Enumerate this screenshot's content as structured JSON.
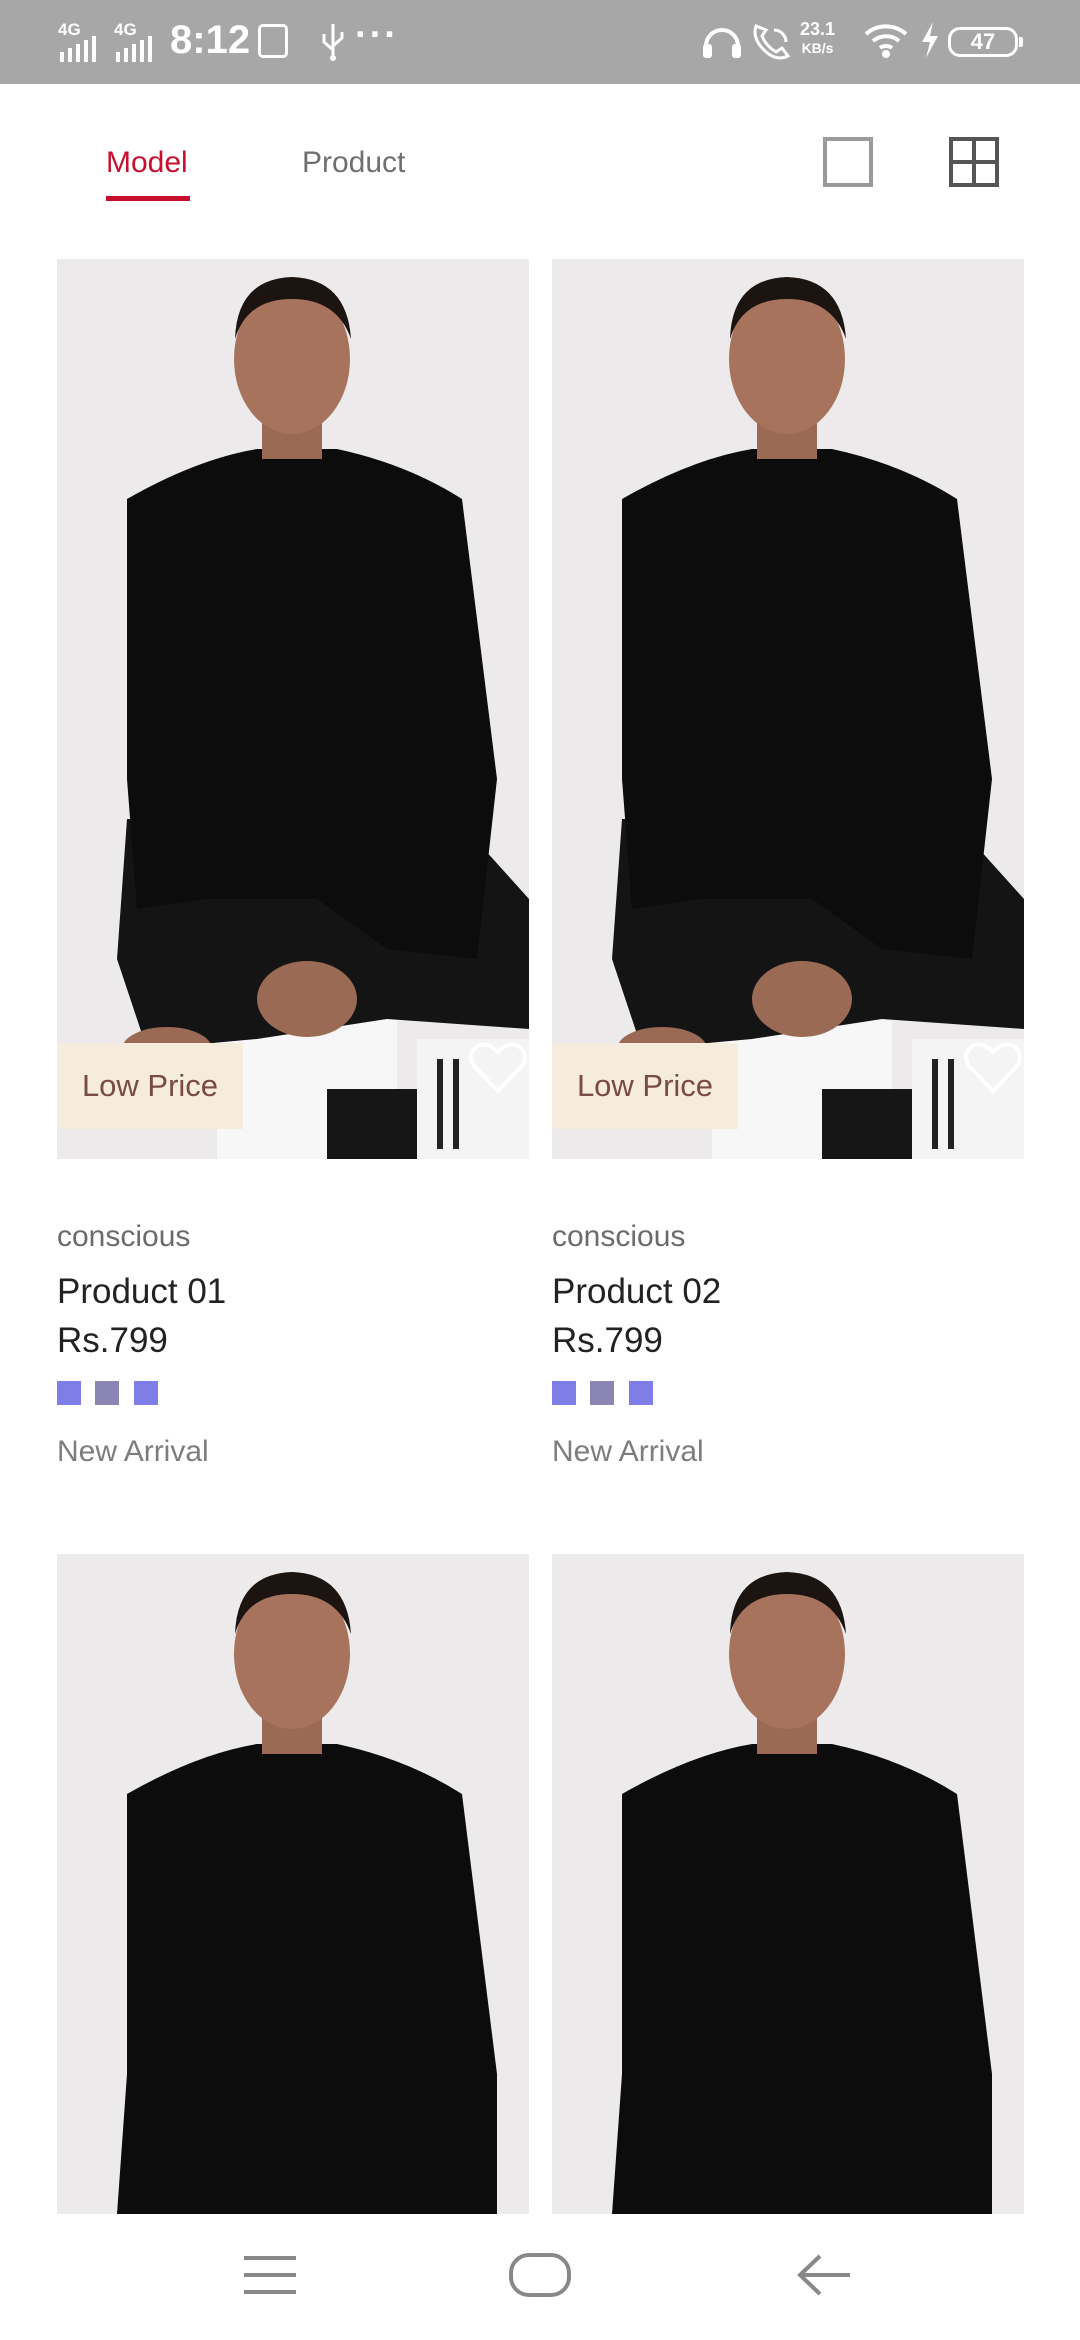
{
  "status_bar": {
    "network1": "4G",
    "network2": "4G",
    "time": "8:12",
    "speed_value": "23.1",
    "speed_unit": "KB/s",
    "battery": "47"
  },
  "tabs": [
    {
      "label": "Model",
      "active": true
    },
    {
      "label": "Product",
      "active": false
    }
  ],
  "view_toggle": {
    "single_icon": "single-view-icon",
    "grid_icon": "grid-view-icon"
  },
  "products": [
    {
      "badge": "Low Price",
      "brand": "conscious",
      "name": "Product 01",
      "price": "Rs.799",
      "swatches": [
        "#7f7ee6",
        "#8a85b3",
        "#7f7ee6"
      ],
      "tag": "New Arrival"
    },
    {
      "badge": "Low Price",
      "brand": "conscious",
      "name": "Product 02",
      "price": "Rs.799",
      "swatches": [
        "#7f7ee6",
        "#8a85b3",
        "#7f7ee6"
      ],
      "tag": "New Arrival"
    },
    {
      "badge": "",
      "brand": "",
      "name": "",
      "price": "",
      "swatches": [],
      "tag": ""
    },
    {
      "badge": "",
      "brand": "",
      "name": "",
      "price": "",
      "swatches": [],
      "tag": ""
    }
  ],
  "colors": {
    "accent": "#c8102e",
    "badge_bg": "#f5ecde"
  },
  "nav": {
    "menu_icon": "menu-icon",
    "home_icon": "home-icon",
    "back_icon": "back-icon"
  }
}
